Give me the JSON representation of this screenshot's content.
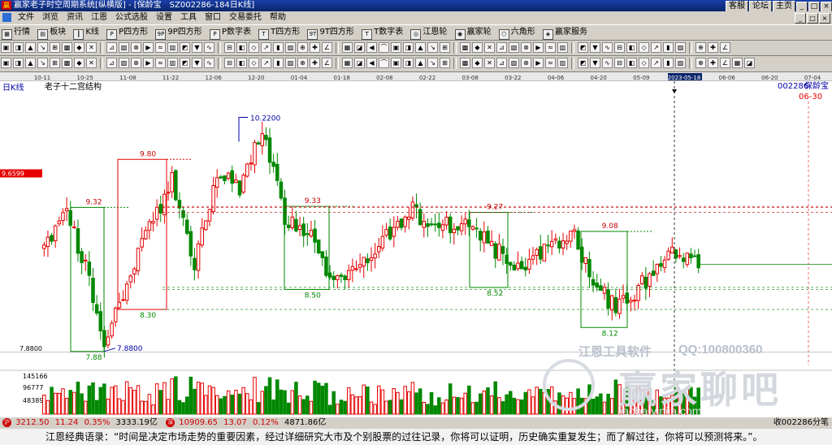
{
  "window": {
    "title": "赢家老子时空周期系统[纵横版] - [保龄宝　SZ002286-184日K线]",
    "right_links": [
      "客服",
      "论坛",
      "主页"
    ],
    "controls": [
      "_",
      "□",
      "×"
    ]
  },
  "menu": [
    "文件",
    "浏览",
    "资讯",
    "江恩",
    "公式选股",
    "设置",
    "工具",
    "窗口",
    "交易委托",
    "帮助"
  ],
  "toolbar": [
    "行情",
    "板块",
    "K线",
    "P四方形",
    "9P四方形",
    "P数字表",
    "T四方形",
    "9T四方形",
    "T数字表",
    "江恩轮",
    "赢家轮",
    "六角形",
    "赢家服务"
  ],
  "colors": {
    "up": "#e60000",
    "down": "#008800",
    "box_up": "#e60000",
    "box_down": "#008800",
    "cursor": "#000000"
  },
  "chart": {
    "period_label": "日K线",
    "indicator_name": "老子十二宫结构",
    "stock_code": "002286",
    "stock_name": "保龄宝",
    "date_label_right": "06-30",
    "cursor_date": "2023-05-18",
    "price_marker": "9.6599",
    "min_price_label": "7.8800",
    "high_label": "10.2200",
    "low_label": "7.8800",
    "date_ticks": [
      "10-11",
      "10-25",
      "11-08",
      "11-22",
      "12-06",
      "12-20",
      "01-04",
      "01-18",
      "02-08",
      "02-22",
      "03-08",
      "03-22",
      "04-06",
      "04-20",
      "05-09",
      "05-18",
      "06-06",
      "06-20",
      "07-04"
    ],
    "box_labels": {
      "a_top": "9.32",
      "a_bottom": "7.88",
      "b_top": "9.80",
      "b_bottom": "8.30",
      "c_top": "9.33",
      "c_bottom": "8.50",
      "d_top": "9.27",
      "d_bottom": "8.52",
      "e_top": "9.08",
      "e_bottom": "8.12"
    },
    "volume_ticks": [
      "145166",
      "96777",
      "48389"
    ]
  },
  "watermark": {
    "line1": "江恩工具软件",
    "qq": "QQ:100800360",
    "brand": "赢家聊吧",
    "url": "jiaoba.yinjia.com"
  },
  "status": {
    "idx1": "3212.50",
    "idx1_chg": "11.24",
    "idx1_pct": "0.35%",
    "idx1_amt": "3333.19亿",
    "idx2": "10909.65",
    "idx2_chg": "13.07",
    "idx2_pct": "0.12%",
    "idx2_amt": "4871.86亿",
    "right": "收002286分笔"
  },
  "quote": "江恩经典语录：“时间是决定市场走势的重要因素，经过详细研究大市及个别股票的过往记录，你将可以证明，历史确实重复发生；而了解过往，你将可以预测将来。”。"
}
